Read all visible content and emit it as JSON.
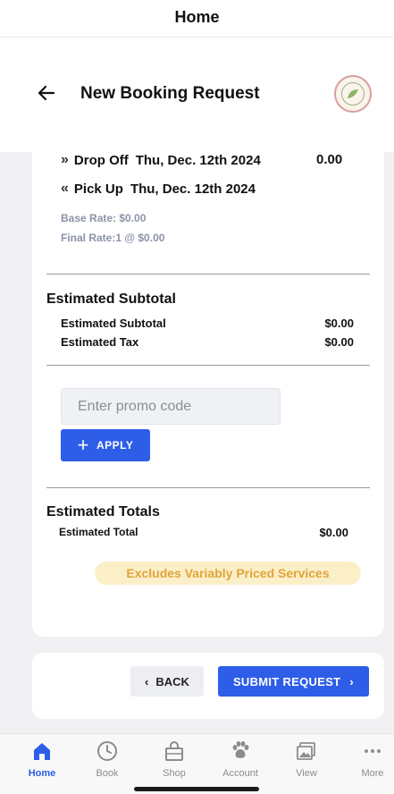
{
  "top_bar": {
    "title": "Home"
  },
  "header": {
    "title": "New Booking Request",
    "back_icon": "back-arrow-icon",
    "logo_icon": "business-logo"
  },
  "booking": {
    "drop_off": {
      "icon": "double-chevron-right-icon",
      "label": "Drop Off",
      "date": "Thu, Dec. 12th 2024",
      "amount": "0.00"
    },
    "pick_up": {
      "icon": "double-chevron-left-icon",
      "label": "Pick Up",
      "date": "Thu, Dec. 12th 2024"
    },
    "base_rate": "Base Rate: $0.00",
    "final_rate": "Final Rate:1 @ $0.00"
  },
  "subtotal": {
    "title": "Estimated Subtotal",
    "rows": [
      {
        "label": "Estimated Subtotal",
        "value": "$0.00"
      },
      {
        "label": "Estimated Tax",
        "value": "$0.00"
      }
    ]
  },
  "promo": {
    "placeholder": "Enter promo code",
    "value": "",
    "apply_label": "APPLY"
  },
  "totals": {
    "title": "Estimated Totals",
    "rows": [
      {
        "label": "Estimated Total",
        "value": "$0.00"
      }
    ],
    "notice": "Excludes Variably Priced Services"
  },
  "actions": {
    "back_label": "BACK",
    "submit_label": "SUBMIT REQUEST"
  },
  "tab_bar": {
    "items": [
      {
        "label": "Home",
        "icon": "home-icon",
        "active": true
      },
      {
        "label": "Book",
        "icon": "clock-icon",
        "active": false
      },
      {
        "label": "Shop",
        "icon": "shop-icon",
        "active": false
      },
      {
        "label": "Account",
        "icon": "paw-icon",
        "active": false
      },
      {
        "label": "View",
        "icon": "gallery-icon",
        "active": false
      },
      {
        "label": "More",
        "icon": "more-icon",
        "active": false
      }
    ]
  },
  "colors": {
    "primary": "#2e5de8",
    "notice_bg": "#fbefc8",
    "notice_text": "#e2a43a",
    "muted": "#8b93a7"
  }
}
